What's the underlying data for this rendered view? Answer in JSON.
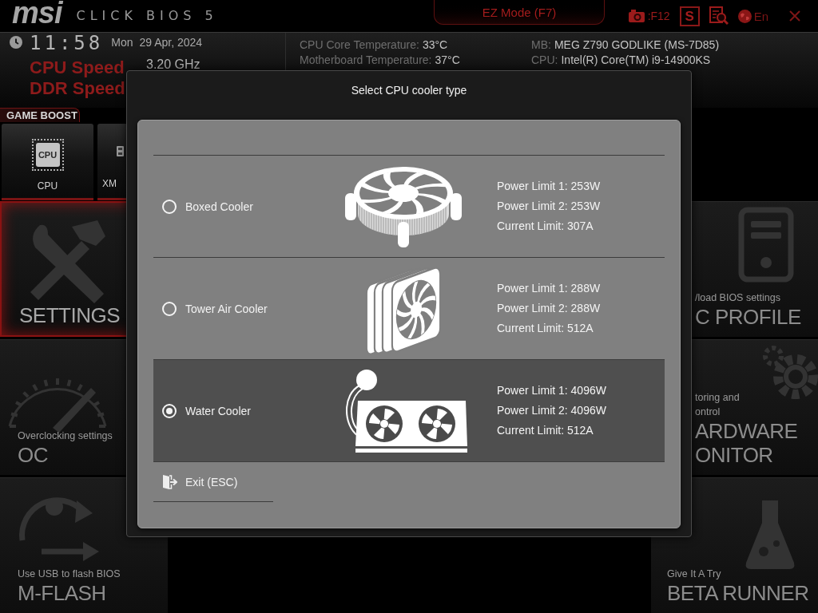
{
  "header": {
    "logo": "msi",
    "product": "CLICK BIOS 5",
    "mode_button": "EZ Mode (F7)",
    "tools": [
      {
        "kind": "screenshot",
        "label": ":F12"
      },
      {
        "kind": "s",
        "label": "S"
      },
      {
        "kind": "search"
      },
      {
        "kind": "language",
        "label": "En"
      },
      {
        "kind": "close"
      }
    ]
  },
  "status": {
    "time": "11:58",
    "day": "Mon",
    "date": "29 Apr, 2024",
    "speeds": [
      {
        "label": "CPU Speed",
        "value": "3.20 GHz"
      },
      {
        "label": "DDR Speed"
      }
    ],
    "sensors": [
      {
        "label": "CPU Core Temperature:",
        "value": "33°C"
      },
      {
        "label": "Motherboard Temperature:",
        "value": "37°C"
      }
    ],
    "system": [
      {
        "label": "MB:",
        "value": "MEG Z790 GODLIKE (MS-7D85)"
      },
      {
        "label": "CPU:",
        "value": "Intel(R) Core(TM) i9-14900KS"
      }
    ]
  },
  "game_boost": {
    "label": "GAME BOOST",
    "tiles": [
      {
        "kind": "cpu",
        "chip_text": "CPU",
        "label": "CPU"
      },
      {
        "kind": "memory",
        "label": "XM"
      }
    ]
  },
  "left_tiles": [
    {
      "kind": "settings",
      "selected": true,
      "title_lines": [
        "SETTINGS"
      ]
    },
    {
      "kind": "oc",
      "selected": false,
      "subtitle_lines": [
        "Overclocking settings"
      ],
      "title_lines": [
        "OC"
      ]
    },
    {
      "kind": "mflash",
      "selected": false,
      "subtitle_lines": [
        "Use USB to flash BIOS"
      ],
      "title_lines": [
        "M-FLASH"
      ]
    }
  ],
  "right_tiles": [
    {
      "kind": "profile",
      "selected": false,
      "subtitle_lines": [
        "/load BIOS settings"
      ],
      "title_lines": [
        "C PROFILE"
      ]
    },
    {
      "kind": "monitor",
      "selected": false,
      "subtitle_lines": [
        "toring and",
        "ontrol"
      ],
      "title_lines": [
        "ARDWARE",
        "ONITOR"
      ]
    },
    {
      "kind": "beta",
      "selected": false,
      "subtitle_lines": [
        "Give It A Try"
      ],
      "title_lines": [
        "BETA RUNNER"
      ]
    }
  ],
  "dialog": {
    "title": "Select CPU cooler type",
    "options": [
      {
        "kind": "boxed",
        "label": "Boxed Cooler",
        "selected": false,
        "specs": [
          "Power Limit 1: 253W",
          "Power Limit 2: 253W",
          "Current Limit: 307A"
        ]
      },
      {
        "kind": "tower",
        "label": "Tower Air Cooler",
        "selected": false,
        "specs": [
          "Power Limit 1: 288W",
          "Power Limit 2: 288W",
          "Current Limit: 512A"
        ]
      },
      {
        "kind": "water",
        "label": "Water Cooler",
        "selected": true,
        "specs": [
          "Power Limit 1: 4096W",
          "Power Limit 2: 4096W",
          "Current Limit: 512A"
        ]
      }
    ],
    "exit": "Exit (ESC)"
  }
}
